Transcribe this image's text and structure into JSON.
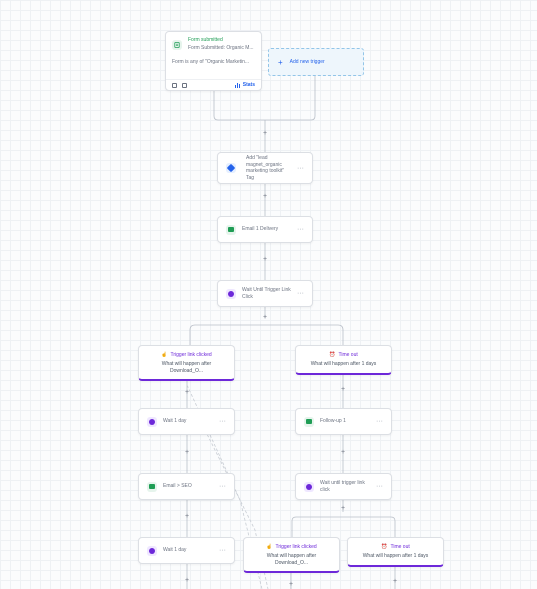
{
  "trigger": {
    "title": "Form submitted",
    "subtitle": "Form Submitted: Organic M...",
    "description": "Form is any of \"Organic Marketin...",
    "stats_label": "Stats"
  },
  "add_trigger_label": "Add new trigger",
  "actions": {
    "add_tag": "Add \"lead magnet_organic marketing toolkit\" Tag",
    "email_delivery": "Email 1 Delivery",
    "wait_trigger_link": "Wait Until Trigger Link Click",
    "wait_1_day_a": "Wait 1 day",
    "email_seo": "Email > SEO",
    "wait_1_day_b": "Wait 1 day",
    "follow_up": "Follow-up 1",
    "wait_trigger_link_2": "Wait until trigger link click"
  },
  "branches": {
    "left_title": "Trigger link clicked",
    "left_sub": "What will happen after Download_O...",
    "right_title": "Time out",
    "right_sub": "What will happen after 1 days",
    "left2_title": "Trigger link clicked",
    "left2_sub": "What will happen after Download_O...",
    "right2_title": "Time out",
    "right2_sub": "What will happen after 1 days"
  },
  "more_glyph": "···",
  "plus_glyph": "+",
  "colors": {
    "accent_blue": "#2563eb",
    "accent_green": "#1f9d55",
    "accent_purple": "#6d28d9"
  },
  "icons": {
    "trigger": "form-icon",
    "tag": "tag-icon",
    "email": "envelope-icon",
    "wait": "clock-icon",
    "branch_clicked": "link-click-icon",
    "branch_timeout": "alarm-icon"
  }
}
